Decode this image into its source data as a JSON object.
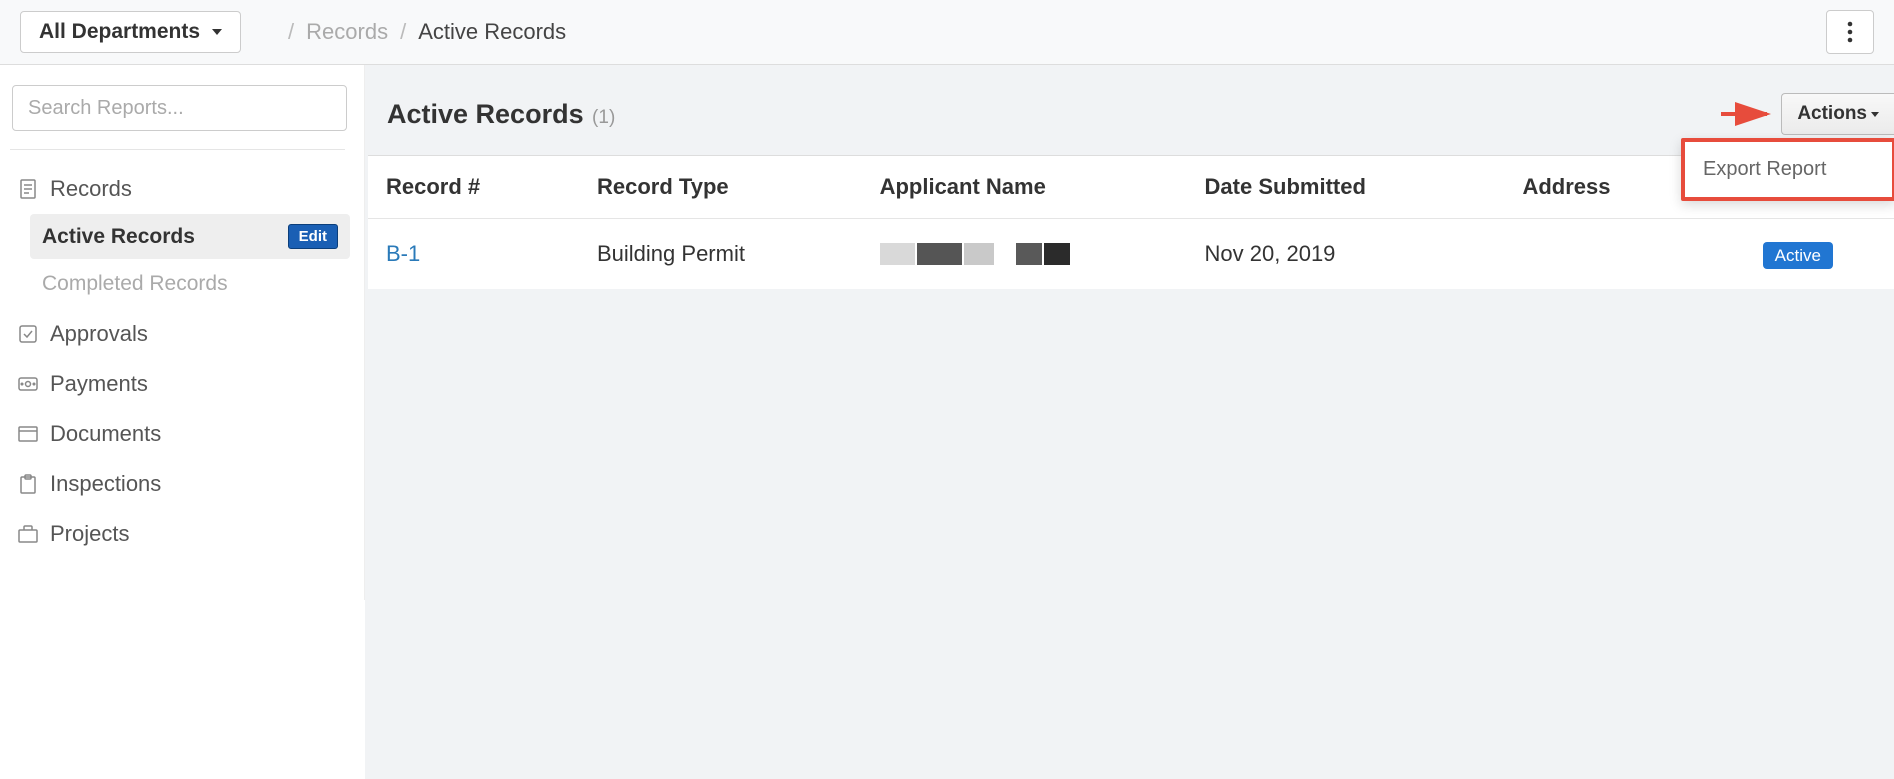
{
  "header": {
    "department_label": "All Departments",
    "breadcrumb": {
      "parent": "Records",
      "current": "Active Records"
    }
  },
  "sidebar": {
    "search_placeholder": "Search Reports...",
    "nav": {
      "records": {
        "label": "Records",
        "children": {
          "active": {
            "label": "Active Records",
            "edit_label": "Edit"
          },
          "completed": {
            "label": "Completed Records"
          }
        }
      },
      "approvals": {
        "label": "Approvals"
      },
      "payments": {
        "label": "Payments"
      },
      "documents": {
        "label": "Documents"
      },
      "inspections": {
        "label": "Inspections"
      },
      "projects": {
        "label": "Projects"
      }
    }
  },
  "main": {
    "title": "Active Records",
    "count": "(1)",
    "actions_button": "Actions",
    "dropdown": {
      "export_report": "Export Report"
    },
    "table": {
      "headers": {
        "record_num": "Record #",
        "record_type": "Record Type",
        "applicant_name": "Applicant Name",
        "date_submitted": "Date Submitted",
        "address": "Address"
      },
      "rows": [
        {
          "record_num": "B-1",
          "record_type": "Building Permit",
          "applicant_name": "",
          "date_submitted": "Nov 20, 2019",
          "address": "",
          "status": "Active"
        }
      ]
    }
  }
}
